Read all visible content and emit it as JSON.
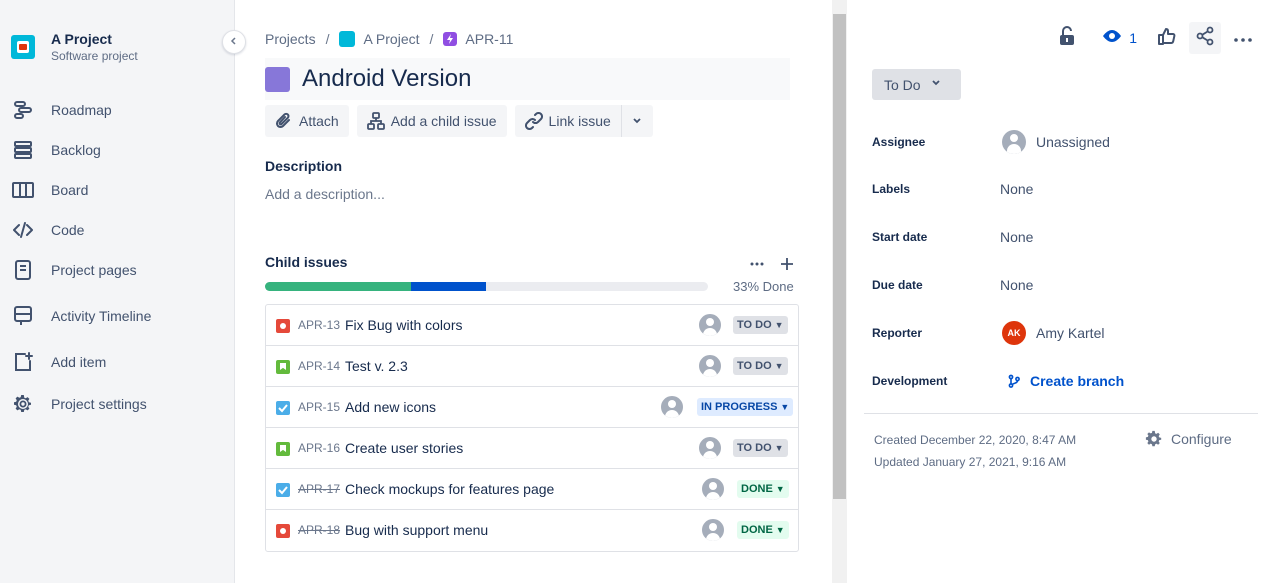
{
  "sidebar": {
    "project_name": "A Project",
    "project_type": "Software project",
    "items": [
      {
        "label": "Roadmap",
        "icon": "roadmap-icon"
      },
      {
        "label": "Backlog",
        "icon": "backlog-icon"
      },
      {
        "label": "Board",
        "icon": "board-icon"
      },
      {
        "label": "Code",
        "icon": "code-icon"
      },
      {
        "label": "Project pages",
        "icon": "pages-icon"
      },
      {
        "label": "Activity Timeline",
        "icon": "timeline-icon"
      },
      {
        "label": "Add item",
        "icon": "add-item-icon"
      },
      {
        "label": "Project settings",
        "icon": "gear-icon"
      }
    ]
  },
  "breadcrumb": {
    "root": "Projects",
    "project": "A Project",
    "issue": "APR-11"
  },
  "issue": {
    "title": "Android Version",
    "actions": {
      "attach": "Attach",
      "add_child": "Add a child issue",
      "link": "Link issue"
    },
    "description_heading": "Description",
    "description_placeholder": "Add a description..."
  },
  "child_issues": {
    "heading": "Child issues",
    "progress_label": "33% Done",
    "progress": {
      "done": 0.33,
      "in_progress": 0.17
    },
    "rows": [
      {
        "key": "APR-13",
        "summary": "Fix Bug with colors",
        "type": "bug",
        "status": "TO DO",
        "status_kind": "todo",
        "resolved": false
      },
      {
        "key": "APR-14",
        "summary": "Test v. 2.3",
        "type": "story",
        "status": "TO DO",
        "status_kind": "todo",
        "resolved": false
      },
      {
        "key": "APR-15",
        "summary": "Add new icons",
        "type": "task",
        "status": "IN PROGRESS",
        "status_kind": "inprog",
        "resolved": false
      },
      {
        "key": "APR-16",
        "summary": "Create user stories",
        "type": "story",
        "status": "TO DO",
        "status_kind": "todo",
        "resolved": false
      },
      {
        "key": "APR-17",
        "summary": "Check mockups for features page",
        "type": "task",
        "status": "DONE",
        "status_kind": "done",
        "resolved": true
      },
      {
        "key": "APR-18",
        "summary": "Bug with support menu",
        "type": "bug",
        "status": "DONE",
        "status_kind": "done",
        "resolved": true
      }
    ]
  },
  "details": {
    "watch_count": "1",
    "status_button": "To Do",
    "fields": {
      "assignee_label": "Assignee",
      "assignee_value": "Unassigned",
      "labels_label": "Labels",
      "labels_value": "None",
      "start_label": "Start date",
      "start_value": "None",
      "due_label": "Due date",
      "due_value": "None",
      "reporter_label": "Reporter",
      "reporter_initials": "AK",
      "reporter_value": "Amy Kartel",
      "development_label": "Development",
      "development_value": "Create branch"
    },
    "created": "Created December 22, 2020, 8:47 AM",
    "updated": "Updated January 27, 2021, 9:16 AM",
    "configure": "Configure"
  },
  "colors": {
    "accent": "#0052cc",
    "done": "#36b37e",
    "epic": "#8777d9",
    "bug": "#e5493a",
    "story": "#63ba3c",
    "task": "#4bade8"
  }
}
